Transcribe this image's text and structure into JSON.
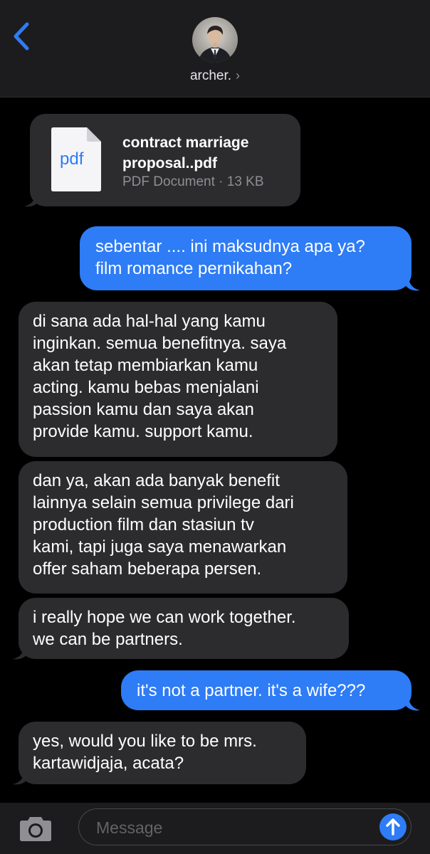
{
  "header": {
    "back_icon": "chevron-left-icon",
    "contact_name": "archer.",
    "contact_chevron": "›",
    "accent_color": "#2e7cf6"
  },
  "attachment": {
    "icon_label": "pdf",
    "file_name": "contract marriage\nproposal..pdf",
    "file_meta": "PDF Document · 13 KB"
  },
  "messages": [
    {
      "direction": "outgoing",
      "text": "sebentar .... ini maksudnya apa ya?\nfilm romance pernikahan?"
    },
    {
      "direction": "incoming",
      "text": "di sana ada hal-hal yang kamu\ninginkan. semua benefitnya. saya\nakan tetap membiarkan kamu\nacting. kamu bebas menjalani\npassion kamu dan saya akan\nprovide kamu. support kamu."
    },
    {
      "direction": "incoming",
      "text": "dan ya, akan ada banyak benefit\nlainnya selain semua privilege dari\nproduction film dan stasiun tv\nkami, tapi juga saya menawarkan\noffer saham beberapa persen."
    },
    {
      "direction": "incoming",
      "text": "i really hope we can work together.\nwe can be partners."
    },
    {
      "direction": "outgoing",
      "text": "it's not a partner. it's a wife???"
    },
    {
      "direction": "incoming",
      "text": "yes, would you like to be mrs.\nkartawidjaja, acata?"
    }
  ],
  "composer": {
    "placeholder": "Message",
    "camera_icon": "camera-icon",
    "send_icon": "arrow-up-icon"
  },
  "colors": {
    "incoming_bubble": "#2c2c2e",
    "outgoing_bubble": "#2e7cf6",
    "background": "#000000",
    "bar": "#1c1c1e"
  }
}
